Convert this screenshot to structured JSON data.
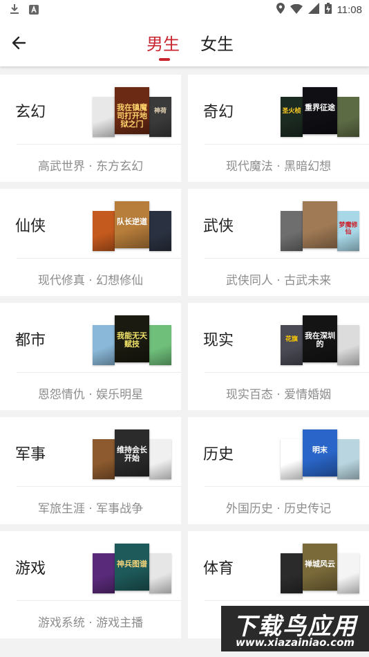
{
  "status_bar": {
    "time": "11:08"
  },
  "header": {
    "tabs": [
      {
        "label": "男生",
        "active": true
      },
      {
        "label": "女生",
        "active": false
      }
    ]
  },
  "colors": {
    "accent": "#c9252f",
    "subtext": "#8d8d8d"
  },
  "categories": [
    {
      "name": "玄幻",
      "sub": "高武世界 · 东方玄幻",
      "covers": [
        {
          "title": "",
          "color": "#e8e8e8",
          "text_color": "#444"
        },
        {
          "title": "我在镇魔司打开地狱之门",
          "color": "#6b2a14",
          "text_color": "#ffd36b"
        },
        {
          "title": "神荷",
          "color": "#3a3a3a",
          "text_color": "#e8d6b5"
        }
      ]
    },
    {
      "name": "奇幻",
      "sub": "现代魔法 · 黑暗幻想",
      "covers": [
        {
          "title": "圣火桢",
          "color": "#1c2b22",
          "text_color": "#ffcc22"
        },
        {
          "title": "重界征途",
          "color": "#0f0f14",
          "text_color": "#ffffff"
        },
        {
          "title": "",
          "color": "#5d6b45",
          "text_color": "#fff"
        }
      ]
    },
    {
      "name": "仙侠",
      "sub": "现代修真 · 幻想修仙",
      "covers": [
        {
          "title": "",
          "color": "#c55a1e",
          "text_color": "#fff"
        },
        {
          "title": "队长逆道",
          "color": "#b77d3a",
          "text_color": "#ffffff"
        },
        {
          "title": "",
          "color": "#2a3140",
          "text_color": "#fff"
        }
      ]
    },
    {
      "name": "武侠",
      "sub": "武侠同人 · 古武未来",
      "covers": [
        {
          "title": "",
          "color": "#6e6e6e",
          "text_color": "#fff"
        },
        {
          "title": "",
          "color": "#a07a55",
          "text_color": "#fff"
        },
        {
          "title": "梦魔修仙",
          "color": "#a8d8e8",
          "text_color": "#c9252f"
        }
      ]
    },
    {
      "name": "都市",
      "sub": "恩怨情仇 · 娱乐明星",
      "covers": [
        {
          "title": "",
          "color": "#8ab8d8",
          "text_color": "#fff"
        },
        {
          "title": "我能无天赋技",
          "color": "#1a1a10",
          "text_color": "#f2e46a"
        },
        {
          "title": "",
          "color": "#6fbf7a",
          "text_color": "#fff"
        }
      ]
    },
    {
      "name": "现实",
      "sub": "现实百态 · 爱情婚姻",
      "covers": [
        {
          "title": "花旗",
          "color": "#4a4a55",
          "text_color": "#ffcc00"
        },
        {
          "title": "我在深圳的",
          "color": "#141414",
          "text_color": "#ffffff"
        },
        {
          "title": "",
          "color": "#dcdcdc",
          "text_color": "#333"
        }
      ]
    },
    {
      "name": "军事",
      "sub": "军旅生涯 · 军事战争",
      "covers": [
        {
          "title": "",
          "color": "#8c5a2e",
          "text_color": "#fff"
        },
        {
          "title": "维持会长开始",
          "color": "#2b2b2b",
          "text_color": "#ffffff"
        },
        {
          "title": "",
          "color": "#f0f0f0",
          "text_color": "#333"
        }
      ]
    },
    {
      "name": "历史",
      "sub": "外国历史 · 历史传记",
      "covers": [
        {
          "title": "",
          "color": "#ffffff",
          "text_color": "#333"
        },
        {
          "title": "明末",
          "color": "#2a66c9",
          "text_color": "#ffffff"
        },
        {
          "title": "",
          "color": "#b9d6e0",
          "text_color": "#333"
        }
      ]
    },
    {
      "name": "游戏",
      "sub": "游戏系统 · 游戏主播",
      "covers": [
        {
          "title": "",
          "color": "#5a2a7a",
          "text_color": "#ffd36b"
        },
        {
          "title": "神兵图谱",
          "color": "#1e5a5a",
          "text_color": "#f2d37a"
        },
        {
          "title": "",
          "color": "#e6e6e6",
          "text_color": "#333"
        }
      ]
    },
    {
      "name": "体育",
      "sub": "",
      "covers": [
        {
          "title": "",
          "color": "#2b2b2b",
          "text_color": "#fff"
        },
        {
          "title": "禅城风云",
          "color": "#7a6a3a",
          "text_color": "#ffffff"
        },
        {
          "title": "",
          "color": "#f4f4f4",
          "text_color": "#333"
        }
      ]
    }
  ],
  "watermark": {
    "title": "下载鸟应用",
    "url": "www.xiazainiao.com"
  }
}
